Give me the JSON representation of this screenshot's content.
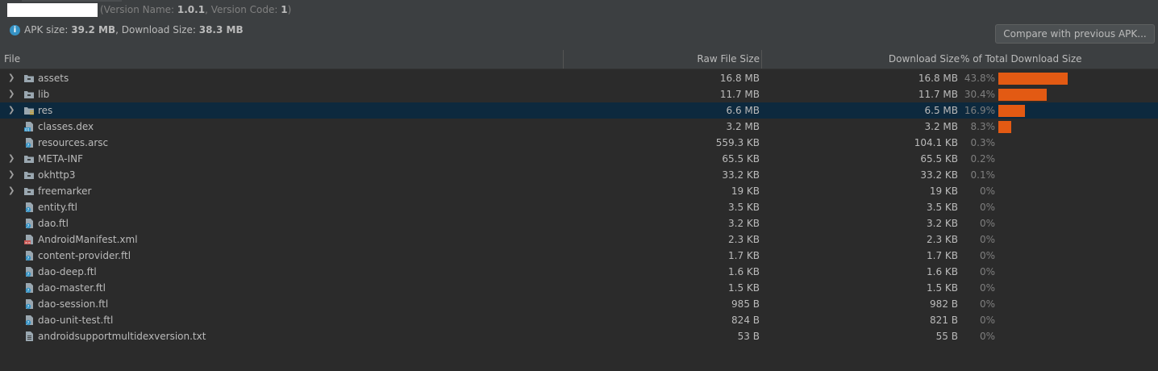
{
  "header": {
    "version_prefix": "(Version Name: ",
    "version_name": "1.0.1",
    "version_mid": ", Version Code: ",
    "version_code": "1",
    "version_suffix": ")",
    "apk_size_label": "APK size: ",
    "apk_size": "39.2 MB",
    "download_size_label": ", Download Size: ",
    "download_size": "38.3 MB",
    "info_icon_glyph": "i",
    "compare_button": "Compare with previous APK..."
  },
  "columns": {
    "file": "File",
    "raw_size": "Raw File Size",
    "download_size": "Download Size",
    "percent_total": "% of Total Download Size"
  },
  "colors": {
    "background": "#2b2b2b",
    "panel": "#3c3f41",
    "selection": "#0d293e",
    "bar": "#e35a13"
  },
  "rows": [
    {
      "name": "assets",
      "icon": "folder-icon",
      "expandable": true,
      "raw": "16.8 MB",
      "download": "16.8 MB",
      "percent": "43.8%",
      "fraction": 0.438
    },
    {
      "name": "lib",
      "icon": "folder-icon",
      "expandable": true,
      "raw": "11.7 MB",
      "download": "11.7 MB",
      "percent": "30.4%",
      "fraction": 0.304
    },
    {
      "name": "res",
      "icon": "resource-folder-icon",
      "expandable": true,
      "selected": true,
      "raw": "6.6 MB",
      "download": "6.5 MB",
      "percent": "16.9%",
      "fraction": 0.169
    },
    {
      "name": "classes.dex",
      "icon": "dex-file-icon",
      "expandable": false,
      "raw": "3.2 MB",
      "download": "3.2 MB",
      "percent": "8.3%",
      "fraction": 0.083
    },
    {
      "name": "resources.arsc",
      "icon": "unknown-file-icon",
      "expandable": false,
      "raw": "559.3 KB",
      "download": "104.1 KB",
      "percent": "0.3%",
      "fraction": 0.003
    },
    {
      "name": "META-INF",
      "icon": "folder-icon",
      "expandable": true,
      "raw": "65.5 KB",
      "download": "65.5 KB",
      "percent": "0.2%",
      "fraction": 0.002
    },
    {
      "name": "okhttp3",
      "icon": "folder-icon",
      "expandable": true,
      "raw": "33.2 KB",
      "download": "33.2 KB",
      "percent": "0.1%",
      "fraction": 0.001
    },
    {
      "name": "freemarker",
      "icon": "folder-icon",
      "expandable": true,
      "raw": "19 KB",
      "download": "19 KB",
      "percent": "0%",
      "fraction": 0
    },
    {
      "name": "entity.ftl",
      "icon": "unknown-file-icon",
      "expandable": false,
      "raw": "3.5 KB",
      "download": "3.5 KB",
      "percent": "0%",
      "fraction": 0
    },
    {
      "name": "dao.ftl",
      "icon": "unknown-file-icon",
      "expandable": false,
      "raw": "3.2 KB",
      "download": "3.2 KB",
      "percent": "0%",
      "fraction": 0
    },
    {
      "name": "AndroidManifest.xml",
      "icon": "xml-file-icon",
      "expandable": false,
      "raw": "2.3 KB",
      "download": "2.3 KB",
      "percent": "0%",
      "fraction": 0
    },
    {
      "name": "content-provider.ftl",
      "icon": "unknown-file-icon",
      "expandable": false,
      "raw": "1.7 KB",
      "download": "1.7 KB",
      "percent": "0%",
      "fraction": 0
    },
    {
      "name": "dao-deep.ftl",
      "icon": "unknown-file-icon",
      "expandable": false,
      "raw": "1.6 KB",
      "download": "1.6 KB",
      "percent": "0%",
      "fraction": 0
    },
    {
      "name": "dao-master.ftl",
      "icon": "unknown-file-icon",
      "expandable": false,
      "raw": "1.5 KB",
      "download": "1.5 KB",
      "percent": "0%",
      "fraction": 0
    },
    {
      "name": "dao-session.ftl",
      "icon": "unknown-file-icon",
      "expandable": false,
      "raw": "985 B",
      "download": "982 B",
      "percent": "0%",
      "fraction": 0
    },
    {
      "name": "dao-unit-test.ftl",
      "icon": "unknown-file-icon",
      "expandable": false,
      "raw": "824 B",
      "download": "821 B",
      "percent": "0%",
      "fraction": 0
    },
    {
      "name": "androidsupportmultidexversion.txt",
      "icon": "text-file-icon",
      "expandable": false,
      "raw": "53 B",
      "download": "55 B",
      "percent": "0%",
      "fraction": 0
    }
  ]
}
